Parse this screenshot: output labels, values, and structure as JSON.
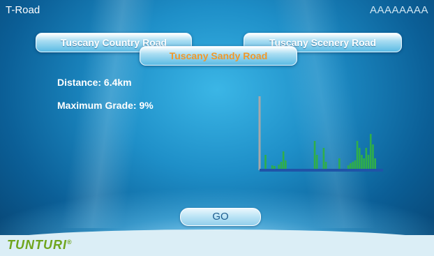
{
  "header": {
    "title": "T-Road",
    "user": "AAAAAAAA"
  },
  "routes": {
    "left": "Tuscany Country Road",
    "selected": "Tuscany Sandy Road",
    "right": "Tuscany Scenery Road"
  },
  "info": {
    "distance": "Distance: 6.4km",
    "max_grade": "Maximum Grade: 9%"
  },
  "chart_data": {
    "type": "bar",
    "title": "",
    "xlabel": "",
    "ylabel": "",
    "ylim": [
      0,
      10
    ],
    "values": [
      0,
      2,
      0,
      0,
      0.5,
      0.4,
      0,
      0.6,
      1,
      2.5,
      1.2,
      0,
      0,
      0,
      0,
      0,
      0,
      0,
      0,
      0,
      0,
      0,
      0,
      4,
      2,
      0,
      0,
      3,
      1,
      0,
      0,
      0,
      0,
      0,
      1.5,
      0,
      0,
      0,
      0.5,
      0.8,
      1,
      1.2,
      4,
      3,
      2,
      1.5,
      3,
      2,
      5,
      3.5,
      1.5,
      0,
      0
    ],
    "colors": {
      "bars": "#2fae4a",
      "axis_x": "#1f54a8",
      "axis_y": "#a8a8a8"
    }
  },
  "actions": {
    "go": "GO"
  },
  "brand": {
    "logo": "TUNTURI",
    "mark": "®",
    "logo_color": "#6fa51d"
  }
}
